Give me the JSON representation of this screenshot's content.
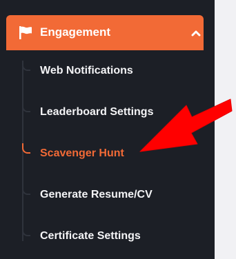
{
  "menu": {
    "header_label": "Engagement",
    "header_icon": "flag-icon",
    "collapse_icon": "chevron-up-icon",
    "accent_color": "#f26a36",
    "items": [
      {
        "label": "Web Notifications"
      },
      {
        "label": "Leaderboard Settings"
      },
      {
        "label": "Scavenger Hunt",
        "active": true
      },
      {
        "label": "Generate Resume/CV"
      },
      {
        "label": "Certificate Settings"
      }
    ]
  },
  "annotation": {
    "icon": "red-arrow-icon",
    "color": "#ff0000"
  }
}
